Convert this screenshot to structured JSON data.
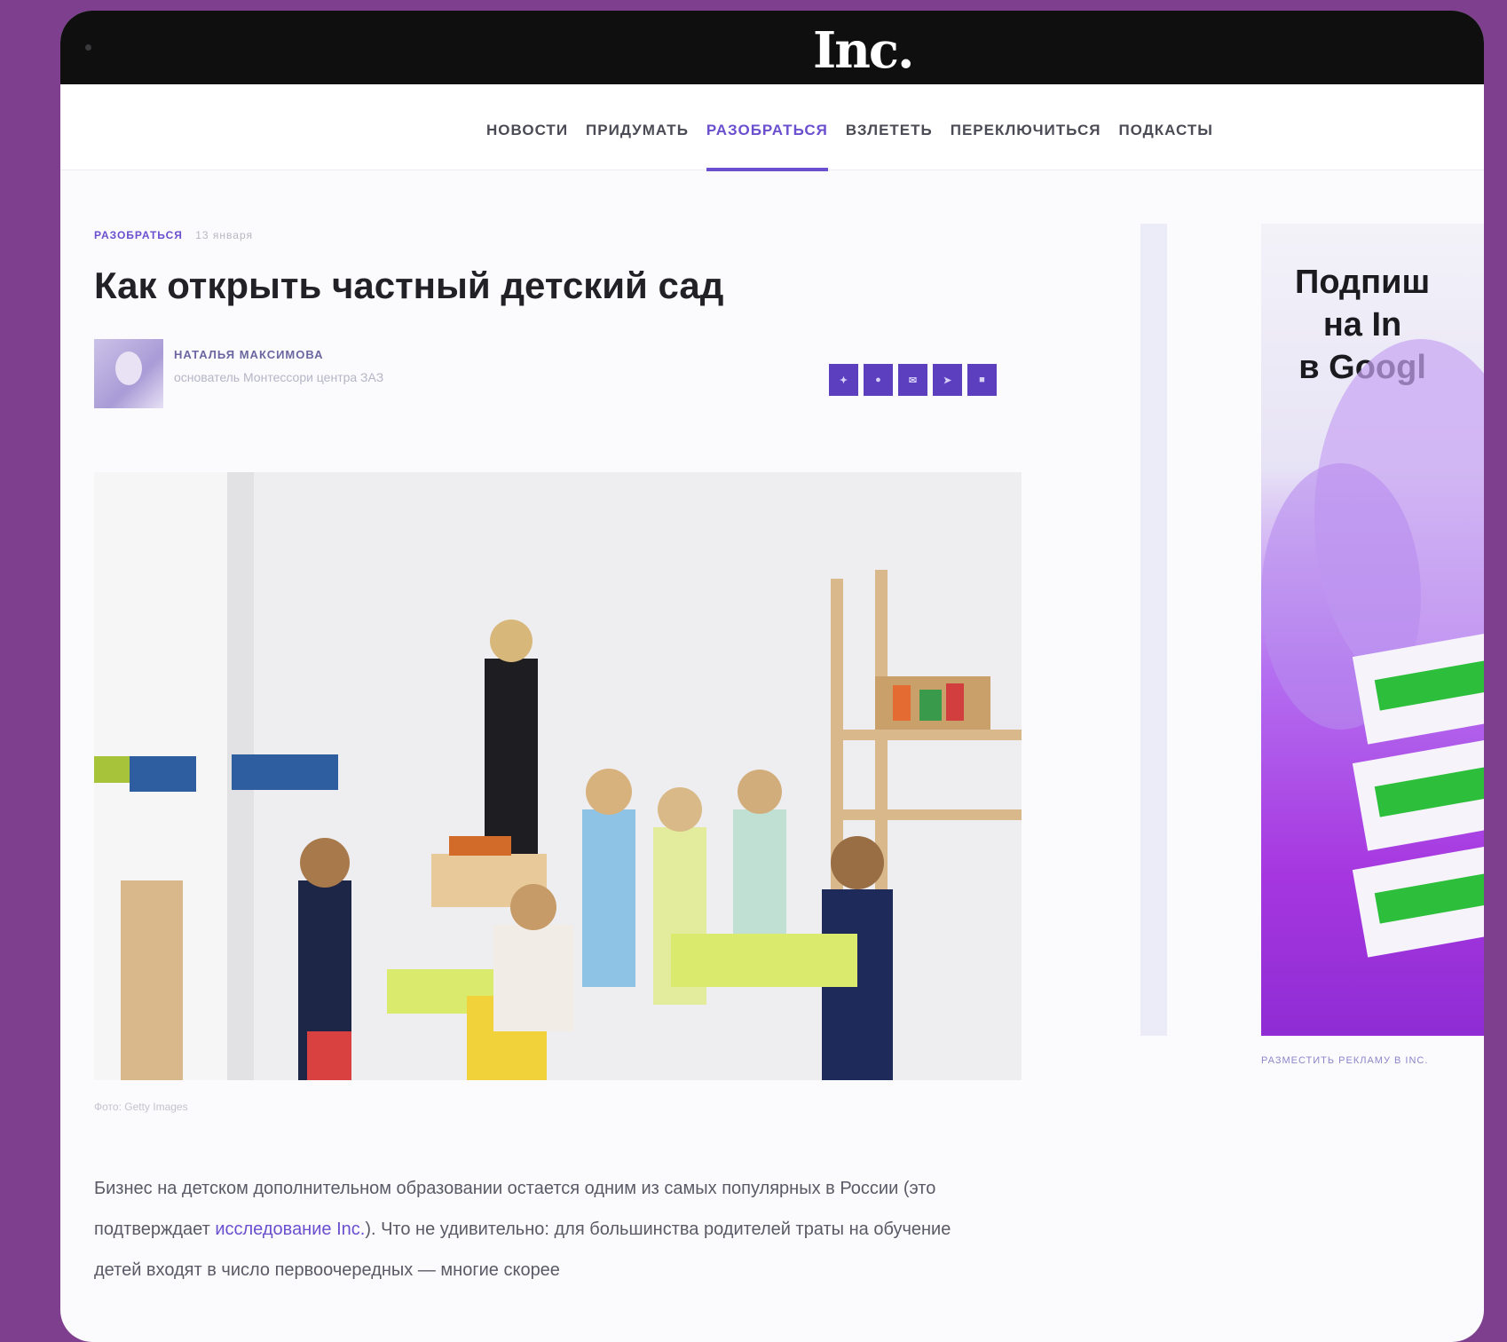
{
  "header": {
    "logo": "Inc."
  },
  "nav": {
    "items": [
      {
        "label": "НОВОСТИ"
      },
      {
        "label": "ПРИДУМАТЬ"
      },
      {
        "label": "РАЗОБРАТЬСЯ"
      },
      {
        "label": "ВЗЛЕТЕТЬ"
      },
      {
        "label": "ПЕРЕКЛЮЧИТЬСЯ"
      },
      {
        "label": "ПОДКАСТЫ"
      }
    ],
    "active_index": 2
  },
  "article": {
    "section": "РАЗОБРАТЬСЯ",
    "date": "13 января",
    "title": "Как открыть частный детский сад",
    "author": {
      "name": "НАТАЛЬЯ МАКСИМОВА",
      "role": "основатель Монтессори центра ЗАЗ"
    },
    "share_icons": [
      "twitter-icon",
      "vk-icon",
      "email-icon",
      "telegram-icon",
      "facebook-icon"
    ],
    "photo_caption": "Фото: Getty Images",
    "body": {
      "part1": "Бизнес на детском дополнительном образовании остается одним из самых популярных в России (это подтверждает ",
      "link": "исследование Inc.",
      "part2": "). Что не удивительно: для большинства родителей траты на обучение детей входят в число первоочередных — многие скорее"
    }
  },
  "ad": {
    "title_lines": [
      "Подпиш",
      "на In",
      "в Googl"
    ],
    "footer": "РАЗМЕСТИТЬ РЕКЛАМУ В INC."
  },
  "colors": {
    "accent": "#6a4fcf",
    "share_button": "#5b3fbf",
    "frame": "#7e3f8e"
  }
}
